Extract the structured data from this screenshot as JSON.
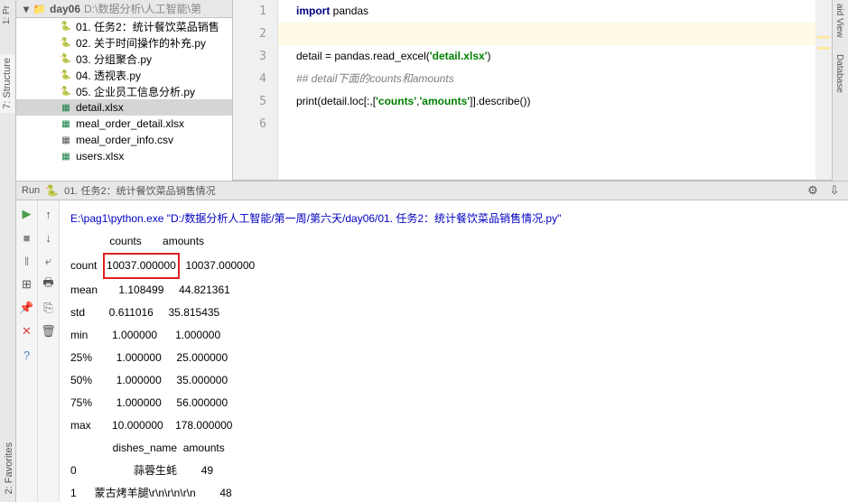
{
  "left_tabs": {
    "project": "1: Pr",
    "structure": "7: Structure",
    "favorites": "2: Favorites"
  },
  "right_tabs": {
    "view": "aid View",
    "database": "Database"
  },
  "project": {
    "root": "day06",
    "root_suffix": "D:\\数据分析\\人工智能\\第",
    "files": [
      {
        "name": "01. 任务2：统计餐饮菜品销售",
        "type": "py"
      },
      {
        "name": "02. 关于时间操作的补充.py",
        "type": "py"
      },
      {
        "name": "03. 分组聚合.py",
        "type": "py"
      },
      {
        "name": "04. 透视表.py",
        "type": "py"
      },
      {
        "name": "05. 企业员工信息分析.py",
        "type": "py"
      },
      {
        "name": "detail.xlsx",
        "type": "xlsx",
        "selected": true
      },
      {
        "name": "meal_order_detail.xlsx",
        "type": "xlsx"
      },
      {
        "name": "meal_order_info.csv",
        "type": "csv"
      },
      {
        "name": "users.xlsx",
        "type": "xlsx"
      }
    ]
  },
  "editor": {
    "lines": [
      {
        "n": "1",
        "html": "<span class='kw'>import</span> pandas"
      },
      {
        "n": "2",
        "html": "",
        "hl": true
      },
      {
        "n": "3",
        "html": "detail = pandas.read_excel(<span class='str'>'detail.xlsx'</span>)"
      },
      {
        "n": "4",
        "html": "<span class='comment'>## detail下面的counts和amounts</span>"
      },
      {
        "n": "5",
        "html": "print(detail.loc[:,[<span class='str'>'counts'</span>,<span class='str'>'amounts'</span>]].describe())"
      },
      {
        "n": "6",
        "html": ""
      }
    ]
  },
  "run": {
    "header_prefix": "Run",
    "header_file": "01. 任务2：统计餐饮菜品销售情况",
    "exec_line": "E:\\pag1\\python.exe \"D:/数据分析人工智能/第一周/第六天/day06/01. 任务2：统计餐饮菜品销售情况.py\"",
    "stats_header": "             counts       amounts",
    "stats": [
      {
        "label": "count",
        "c": "10037.000000",
        "a": "10037.000000",
        "hl": true
      },
      {
        "label": "mean ",
        "c": "    1.108499",
        "a": "   44.821361"
      },
      {
        "label": "std  ",
        "c": "    0.611016",
        "a": "   35.815435"
      },
      {
        "label": "min  ",
        "c": "    1.000000",
        "a": "    1.000000"
      },
      {
        "label": "25%  ",
        "c": "    1.000000",
        "a": "   25.000000"
      },
      {
        "label": "50%  ",
        "c": "    1.000000",
        "a": "   35.000000"
      },
      {
        "label": "75%  ",
        "c": "    1.000000",
        "a": "   56.000000"
      },
      {
        "label": "max  ",
        "c": "   10.000000",
        "a": "  178.000000"
      }
    ],
    "dishes_header": "              dishes_name  amounts",
    "dishes": [
      {
        "idx": "0",
        "name": "                 蒜蓉生蚝",
        "amt": "      49"
      },
      {
        "idx": "1",
        "name": "    蒙古烤羊腿\\r\\n\\r\\n\\r\\n",
        "amt": "      48"
      }
    ]
  }
}
